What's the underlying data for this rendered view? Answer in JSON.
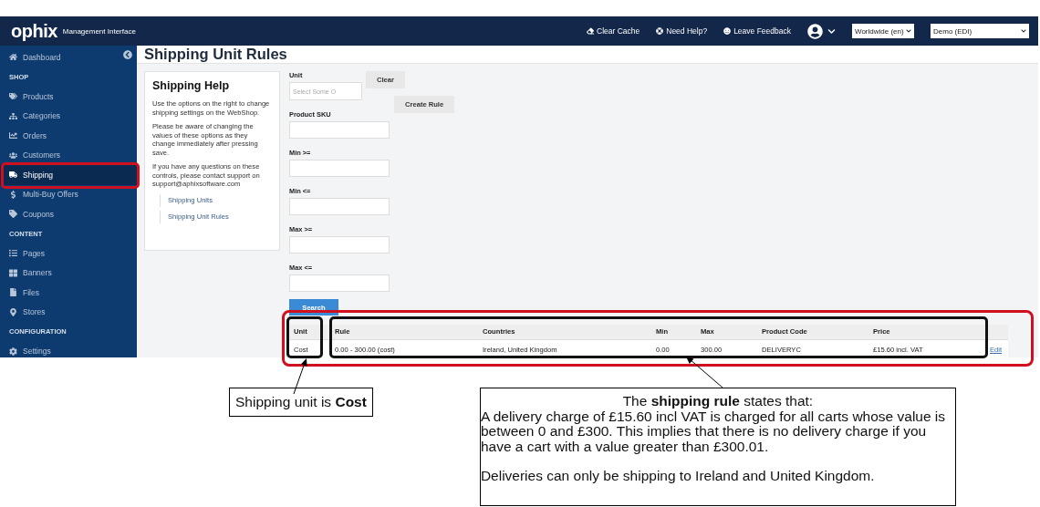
{
  "header": {
    "logo": "ophix",
    "subtitle": "Management Interface",
    "links": [
      {
        "label": "Clear Cache"
      },
      {
        "label": "Need Help?"
      },
      {
        "label": "Leave Feedback"
      }
    ],
    "selects": [
      {
        "value": "Worldwide (en)"
      },
      {
        "value": "Demo (EDI)"
      }
    ]
  },
  "sidebar": {
    "items": [
      {
        "kind": "link",
        "label": "Dashboard",
        "selected": false
      },
      {
        "kind": "section",
        "label": "SHOP"
      },
      {
        "kind": "link",
        "label": "Products",
        "selected": false
      },
      {
        "kind": "link",
        "label": "Categories",
        "selected": false
      },
      {
        "kind": "link",
        "label": "Orders",
        "selected": false
      },
      {
        "kind": "link",
        "label": "Customers",
        "selected": false
      },
      {
        "kind": "link",
        "label": "Shipping",
        "selected": true
      },
      {
        "kind": "link",
        "label": "Multi-Buy Offers",
        "selected": false
      },
      {
        "kind": "link",
        "label": "Coupons",
        "selected": false
      },
      {
        "kind": "section",
        "label": "CONTENT"
      },
      {
        "kind": "link",
        "label": "Pages",
        "selected": false
      },
      {
        "kind": "link",
        "label": "Banners",
        "selected": false
      },
      {
        "kind": "link",
        "label": "Files",
        "selected": false
      },
      {
        "kind": "link",
        "label": "Stores",
        "selected": false
      },
      {
        "kind": "section",
        "label": "CONFIGURATION"
      },
      {
        "kind": "link",
        "label": "Settings",
        "selected": false
      }
    ]
  },
  "page_title": "Shipping Unit Rules",
  "help": {
    "title": "Shipping Help",
    "paragraphs": [
      "Use the options on the right to change shipping settings on the WebShop.",
      "Please be aware of changing the values of these options as they change immediately after pressing save.",
      "If you have any questions on these controls, please contact support on support@aphixsoftware.com"
    ],
    "links": [
      "Shipping Units",
      "Shipping Unit Rules"
    ]
  },
  "filters": {
    "unit": {
      "label": "Unit",
      "placeholder": "Select Some O"
    },
    "fields": [
      {
        "label": "Product SKU"
      },
      {
        "label": "Min >="
      },
      {
        "label": "Min <="
      },
      {
        "label": "Max >="
      },
      {
        "label": "Max <="
      }
    ],
    "clear_button": "Clear",
    "create_button": "Create Rule",
    "search_button": "Search"
  },
  "table": {
    "columns": [
      "Unit",
      "Rule",
      "Countries",
      "Min",
      "Max",
      "Product Code",
      "Price"
    ],
    "rows": [
      {
        "cells": [
          "Cost",
          "0.00 - 300.00 (cost)",
          "Ireland, United Kingdom",
          "0.00",
          "300.00",
          "DELIVERYC",
          "£15.60 incl. VAT"
        ],
        "action": "Edit"
      }
    ]
  },
  "annotations": {
    "unit_callout": "Shipping unit is **Cost**",
    "rule_callout": {
      "title": "The **shipping rule** states that:",
      "paragraphs": [
        "A delivery charge of £15.60 incl VAT is charged for all carts whose value is between 0 and £300. This implies that there is no delivery charge if you have a cart with a value greater than £300.01.",
        "Deliveries can only be shipping to Ireland and United Kingdom."
      ]
    }
  }
}
